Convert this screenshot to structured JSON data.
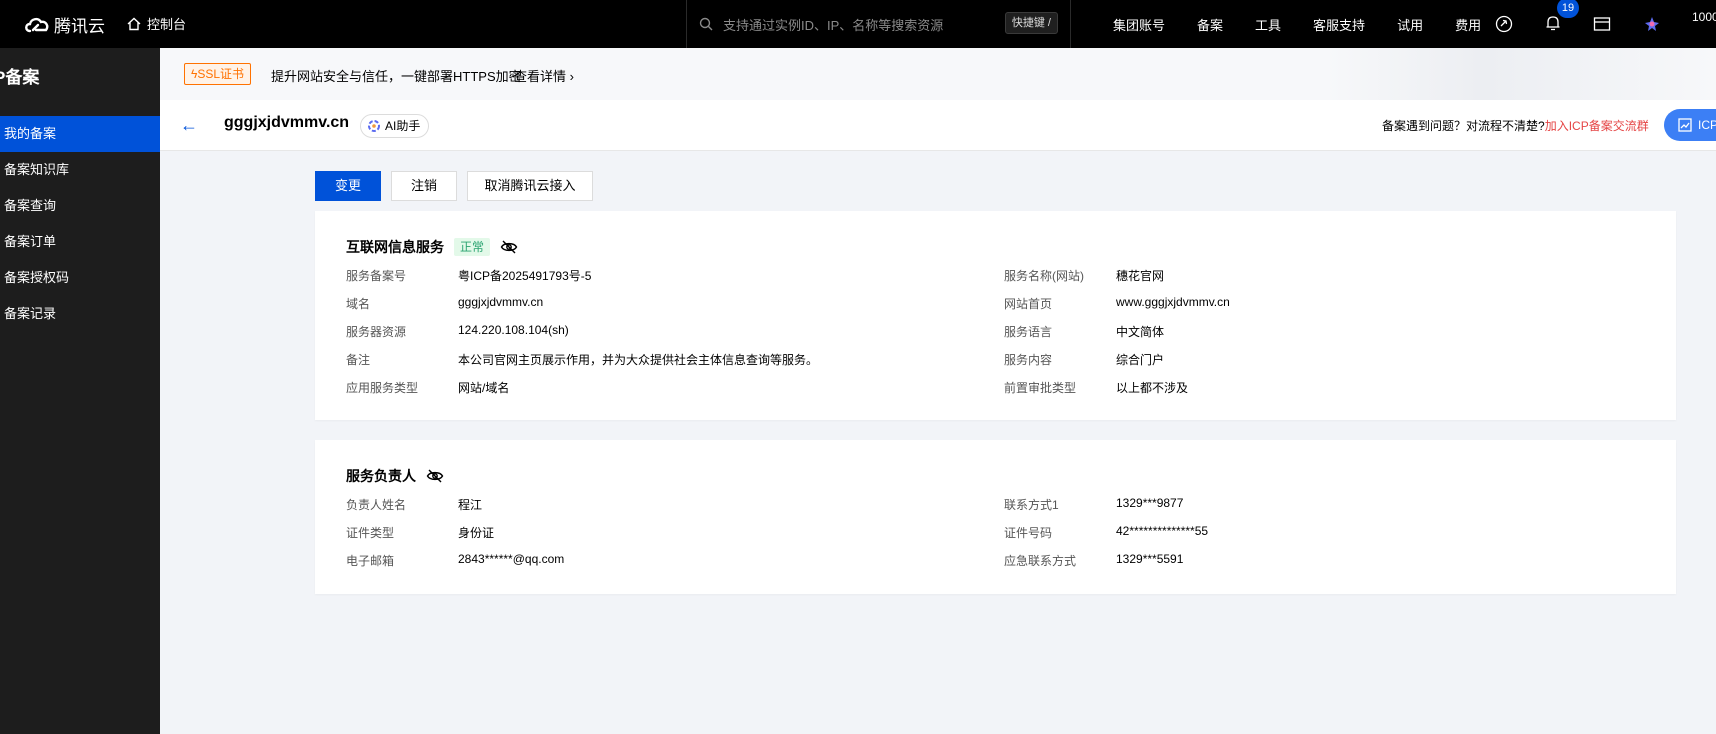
{
  "topbar": {
    "brand": "腾讯云",
    "console": "控制台",
    "search_placeholder": "支持通过实例ID、IP、名称等搜索资源",
    "shortcut": "快捷键 /",
    "nav": [
      "集团账号",
      "备案",
      "工具",
      "客服支持",
      "试用",
      "费用"
    ],
    "notification_count": "19",
    "account": "1000"
  },
  "sidebar": {
    "title": "P备案",
    "items": [
      "我的备案",
      "备案知识库",
      "备案查询",
      "备案订单",
      "备案授权码",
      "备案记录"
    ],
    "active_index": 0
  },
  "banner": {
    "tag": "SSL证书",
    "text": "提升网站安全与信任，一键部署HTTPS加密",
    "link": "查看详情"
  },
  "header": {
    "title": "gggjxjdvmmv.cn",
    "ai_button": "AI助手",
    "help_prefix": "备案遇到问题？对流程不清楚?",
    "help_link": "加入ICP备案交流群",
    "icp_button": "ICP"
  },
  "actions": {
    "change": "变更",
    "cancel": "注销",
    "unlink": "取消腾讯云接入"
  },
  "service_card": {
    "title": "互联网信息服务",
    "status": "正常",
    "left": [
      {
        "label": "服务备案号",
        "value": "粤ICP备2025491793号-5"
      },
      {
        "label": "域名",
        "value": "gggjxjdvmmv.cn"
      },
      {
        "label": "服务器资源",
        "value": "124.220.108.104(sh)"
      },
      {
        "label": "备注",
        "value": "本公司官网主页展示作用，并为大众提供社会主体信息查询等服务。"
      },
      {
        "label": "应用服务类型",
        "value": "网站/域名"
      }
    ],
    "right": [
      {
        "label": "服务名称(网站)",
        "value": "穗花官网"
      },
      {
        "label": "网站首页",
        "value": "www.gggjxjdvmmv.cn"
      },
      {
        "label": "服务语言",
        "value": "中文简体"
      },
      {
        "label": "服务内容",
        "value": "综合门户"
      },
      {
        "label": "前置审批类型",
        "value": "以上都不涉及"
      }
    ]
  },
  "owner_card": {
    "title": "服务负责人",
    "left": [
      {
        "label": "负责人姓名",
        "value": "程江"
      },
      {
        "label": "证件类型",
        "value": "身份证"
      },
      {
        "label": "电子邮箱",
        "value": "2843******@qq.com"
      }
    ],
    "right": [
      {
        "label": "联系方式1",
        "value": "1329***9877"
      },
      {
        "label": "证件号码",
        "value": "42**************55"
      },
      {
        "label": "应急联系方式",
        "value": "1329***5591"
      }
    ]
  },
  "colors": {
    "primary": "#0052d9",
    "success": "#2ba471",
    "warning": "#ff7200",
    "danger": "#e54545"
  }
}
